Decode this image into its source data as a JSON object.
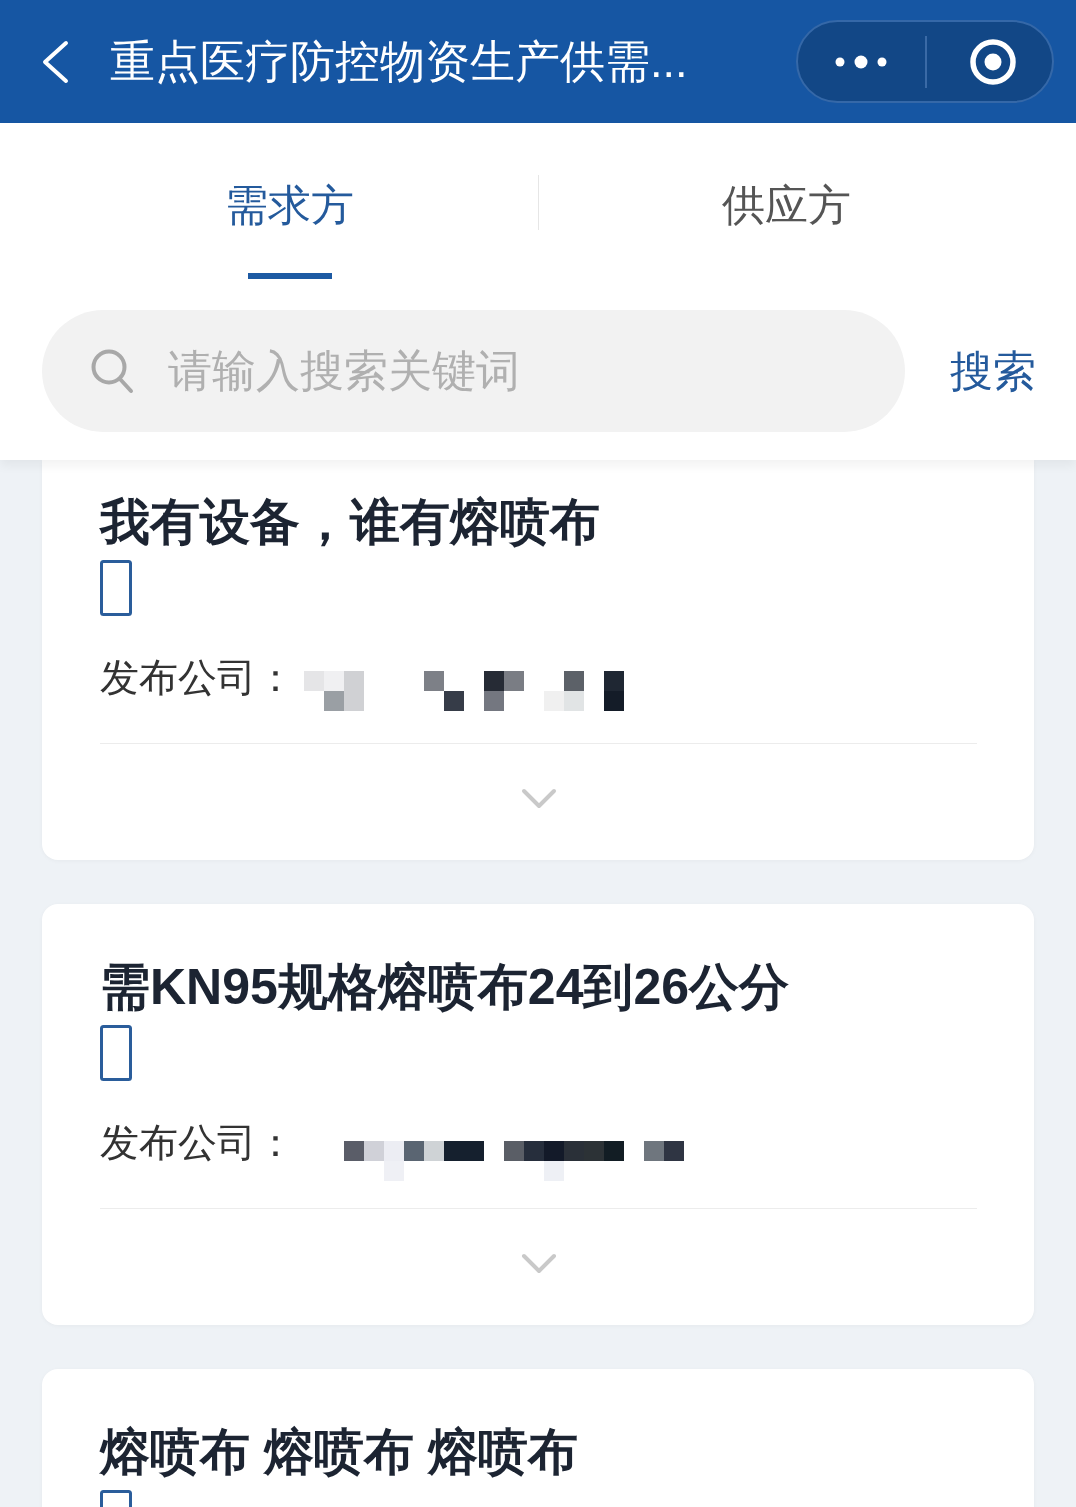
{
  "header": {
    "title": "重点医疗防控物资生产供需..."
  },
  "tabs": [
    {
      "label": "需求方",
      "selected": true
    },
    {
      "label": "供应方",
      "selected": false
    }
  ],
  "search": {
    "placeholder": "请输入搜索关键词",
    "button": "搜索"
  },
  "cards": [
    {
      "title": "我有设备，谁有熔喷布",
      "company_label": "发布公司：",
      "expanded": false
    },
    {
      "title": "需KN95规格熔喷布24到26公分",
      "company_label": "发布公司：",
      "expanded": false
    },
    {
      "title": "熔喷布 熔喷布 熔喷布"
    }
  ]
}
